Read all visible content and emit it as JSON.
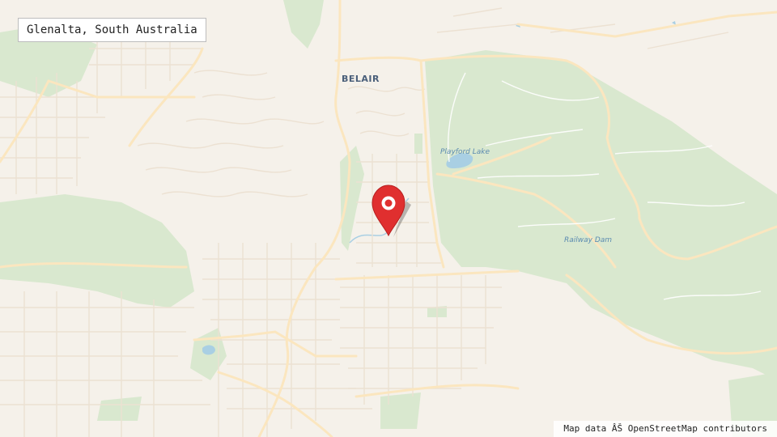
{
  "location": {
    "label": "Glenalta, South Australia"
  },
  "map": {
    "labels": {
      "belair": "BELAIR",
      "playford_lake": "Playford Lake",
      "railway_dam": "Railway Dam"
    },
    "attribution": "Map data ÂŠ OpenStreetMap contributors",
    "colors": {
      "land": "#f5f1ea",
      "park": "#d9e8cf",
      "road": "#fbe6bf",
      "street": "#ede4d6",
      "water": "#a9cfe3",
      "marker": "#e02f2f"
    },
    "marker_icon": "map-pin-icon"
  }
}
